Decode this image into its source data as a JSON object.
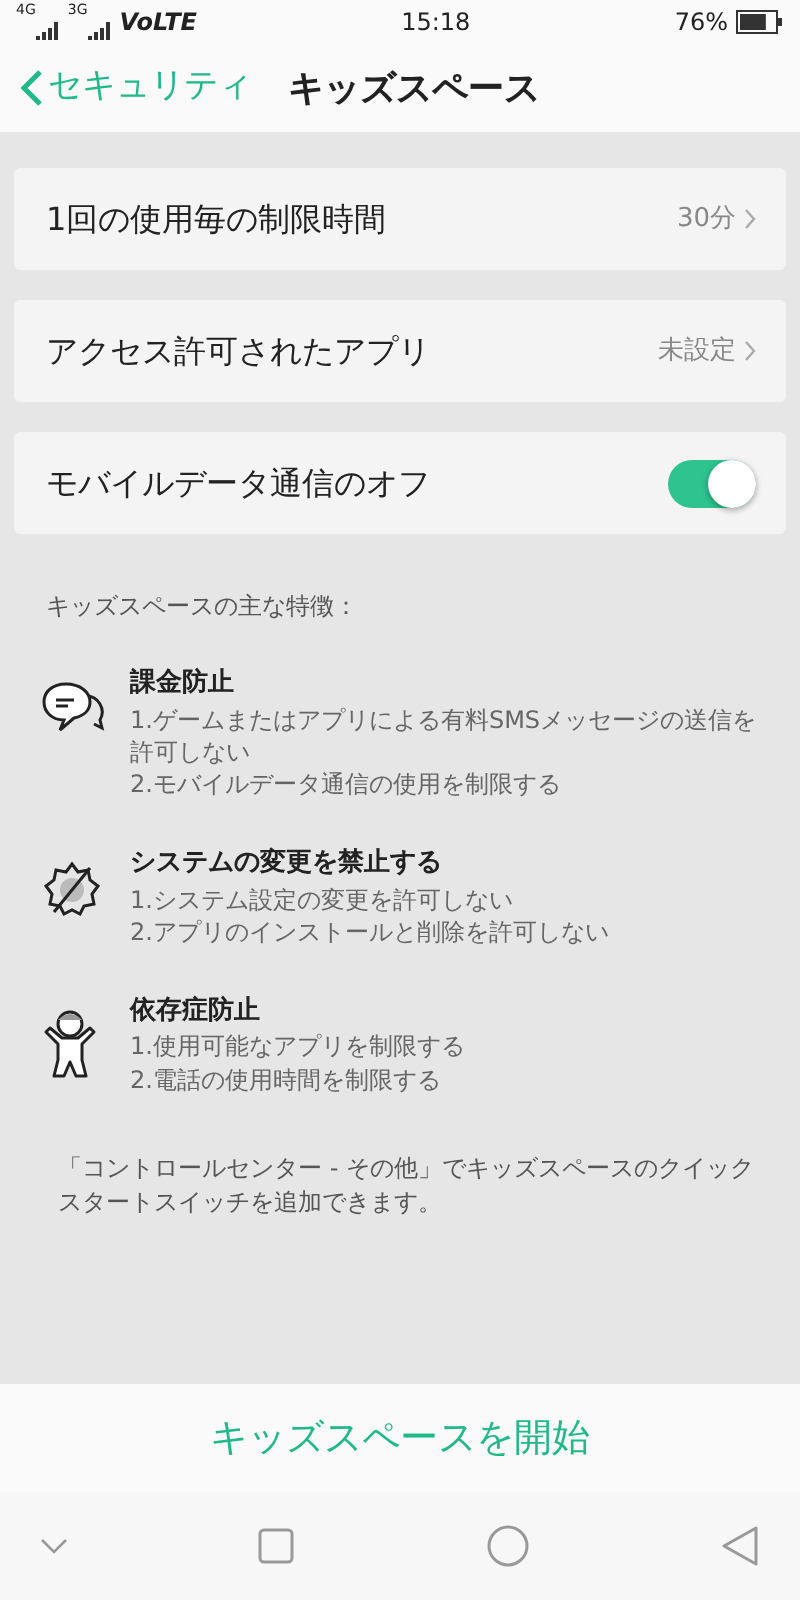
{
  "status_bar": {
    "network_1": "4G",
    "network_2": "3G",
    "carrier_mode": "VoLTE",
    "time": "15:18",
    "battery": "76%"
  },
  "header": {
    "back": "セキュリティ",
    "title": "キッズスペース"
  },
  "settings": [
    {
      "kind": "value",
      "label": "1回の使用毎の制限時間",
      "value": "30分"
    },
    {
      "kind": "value",
      "label": "アクセス許可されたアプリ",
      "value": "未設定"
    },
    {
      "kind": "toggle",
      "label": "モバイルデータ通信のオフ",
      "on": true
    }
  ],
  "features_heading": "キッズスペースの主な特徴：",
  "features": [
    {
      "title": "課金防止",
      "lines": [
        "1.ゲームまたはアプリによる有料SMSメッセージの送信を許可しない",
        "2.モバイルデータ通信の使用を制限する"
      ]
    },
    {
      "title": "システムの変更を禁止する",
      "lines": [
        "1.システム設定の変更を許可しない",
        "2.アプリのインストールと削除を許可しない"
      ]
    },
    {
      "title": "依存症防止",
      "lines": [
        "1.使用可能なアプリを制限する",
        "2.電話の使用時間を制限する"
      ]
    }
  ],
  "note": "「コントロールセンター - その他」でキッズスペースのクイックスタートスイッチを追加できます。",
  "start_button": "キッズスペースを開始"
}
